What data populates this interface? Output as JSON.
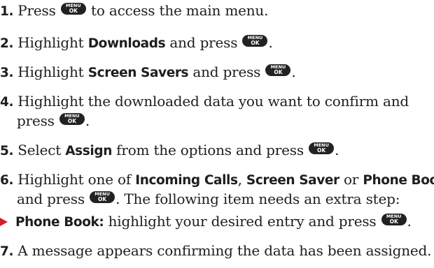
{
  "key": {
    "top": "MENU",
    "bottom": "OK"
  },
  "colors": {
    "text": "#1e1e1e",
    "key_bg": "#222222",
    "bullet": "#d01f2a"
  },
  "steps": [
    {
      "num": "1.",
      "a": "Press",
      "b": "to access the main menu."
    },
    {
      "num": "2.",
      "a": "Highlight",
      "bold": "Downloads",
      "b": "and press",
      "c": "."
    },
    {
      "num": "3.",
      "a": "Highlight",
      "bold": "Screen Savers",
      "b": "and press",
      "c": "."
    },
    {
      "num": "4.",
      "line1": "Highlight the downloaded data you want to confirm and",
      "line2": "press",
      "c": "."
    },
    {
      "num": "5.",
      "a": "Select",
      "bold": "Assign",
      "b": "from the options and press",
      "c": "."
    },
    {
      "num": "6.",
      "a": "Highlight one of",
      "bold1": "Incoming Calls",
      "sep1": ",",
      "bold2": "Screen Saver",
      "or": "or",
      "bold3": "Phone Book",
      "sep2": ",",
      "line2a": "and press",
      "line2b": ". The following item needs an extra step:"
    },
    {
      "num": "7.",
      "text": "A message appears confirming the data has been assigned."
    }
  ],
  "sub_bullet": {
    "bold": "Phone Book:",
    "text": "highlight your desired entry and press",
    "c": "."
  }
}
